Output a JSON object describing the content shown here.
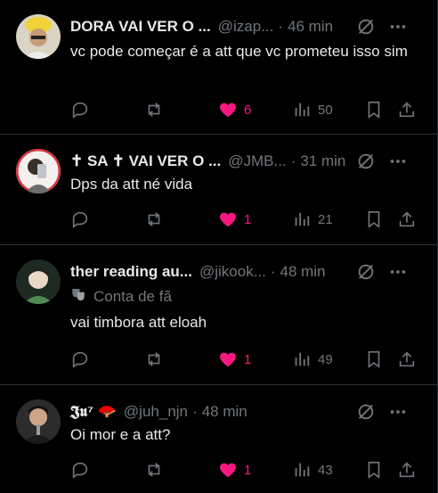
{
  "colors": {
    "background": "#000000",
    "text": "#e7e9ea",
    "muted": "#71767b",
    "like": "#f91880",
    "divider": "#2f3336"
  },
  "icons": {
    "grok": "grok-icon",
    "more": "more-icon",
    "reply": "reply-icon",
    "repost": "repost-icon",
    "like": "heart-icon",
    "views": "views-icon",
    "bookmark": "bookmark-icon",
    "share": "share-icon",
    "badge": "theater-mask-icon"
  },
  "posts": [
    {
      "display_name": "DORA VAI VER O ...",
      "handle": "@izap...",
      "separator": "·",
      "time": "46 min",
      "text": "vc pode começar é a att que vc prometeu isso sim",
      "likes": "6",
      "views": "50",
      "liked": true
    },
    {
      "display_name": "✝ SA ✝ VAI VER O ...",
      "handle": "@JMB...",
      "separator": "·",
      "time": "31 min",
      "text": "Dps da att né vida",
      "likes": "1",
      "views": "21",
      "liked": true
    },
    {
      "display_name": "ther reading au...",
      "handle": "@jikook...",
      "separator": "·",
      "time": "48 min",
      "badge": "Conta de fã",
      "text": "vai timbora att eloah",
      "likes": "1",
      "views": "49",
      "liked": true
    },
    {
      "display_name": "𝕵𝖚⁷ 🪭",
      "handle": "@juh_njn",
      "separator": "·",
      "time": "48 min",
      "text": "Oi mor e a att?",
      "likes": "1",
      "views": "43",
      "liked": true
    }
  ]
}
